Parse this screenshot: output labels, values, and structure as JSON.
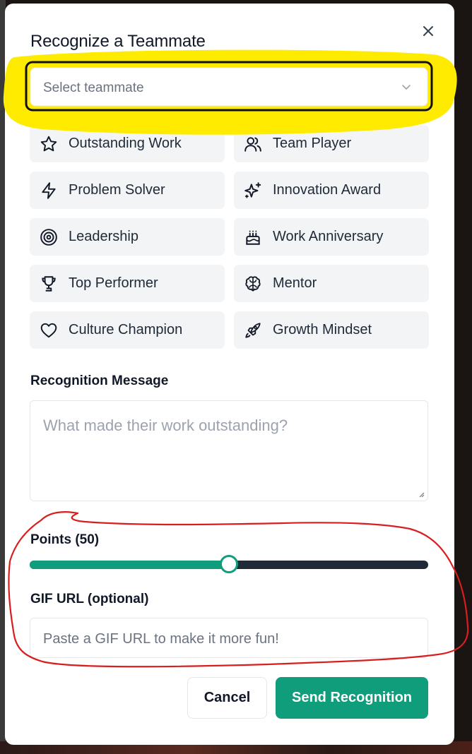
{
  "modal": {
    "title": "Recognize a Teammate",
    "close_icon": "close-icon"
  },
  "teammate_select": {
    "placeholder": "Select teammate",
    "icon": "chevron-down-icon"
  },
  "badges": [
    {
      "label": "Outstanding Work",
      "icon": "star-icon"
    },
    {
      "label": "Team Player",
      "icon": "users-icon"
    },
    {
      "label": "Problem Solver",
      "icon": "zap-icon"
    },
    {
      "label": "Innovation Award",
      "icon": "sparkles-icon"
    },
    {
      "label": "Leadership",
      "icon": "target-icon"
    },
    {
      "label": "Work Anniversary",
      "icon": "cake-icon"
    },
    {
      "label": "Top Performer",
      "icon": "trophy-icon"
    },
    {
      "label": "Mentor",
      "icon": "brain-icon"
    },
    {
      "label": "Culture Champion",
      "icon": "heart-icon"
    },
    {
      "label": "Growth Mindset",
      "icon": "rocket-icon"
    }
  ],
  "message": {
    "label": "Recognition Message",
    "placeholder": "What made their work outstanding?"
  },
  "points": {
    "label": "Points (50)",
    "value": 50,
    "min": 0,
    "max": 100
  },
  "gif": {
    "label": "GIF URL (optional)",
    "placeholder": "Paste a GIF URL to make it more fun!"
  },
  "actions": {
    "cancel_label": "Cancel",
    "send_label": "Send Recognition"
  },
  "colors": {
    "accent": "#0f9d7c",
    "track": "#1f2937",
    "badge_bg": "#f3f4f6",
    "yellow_annotation": "#ffeb00",
    "red_annotation": "#d81e1e"
  }
}
